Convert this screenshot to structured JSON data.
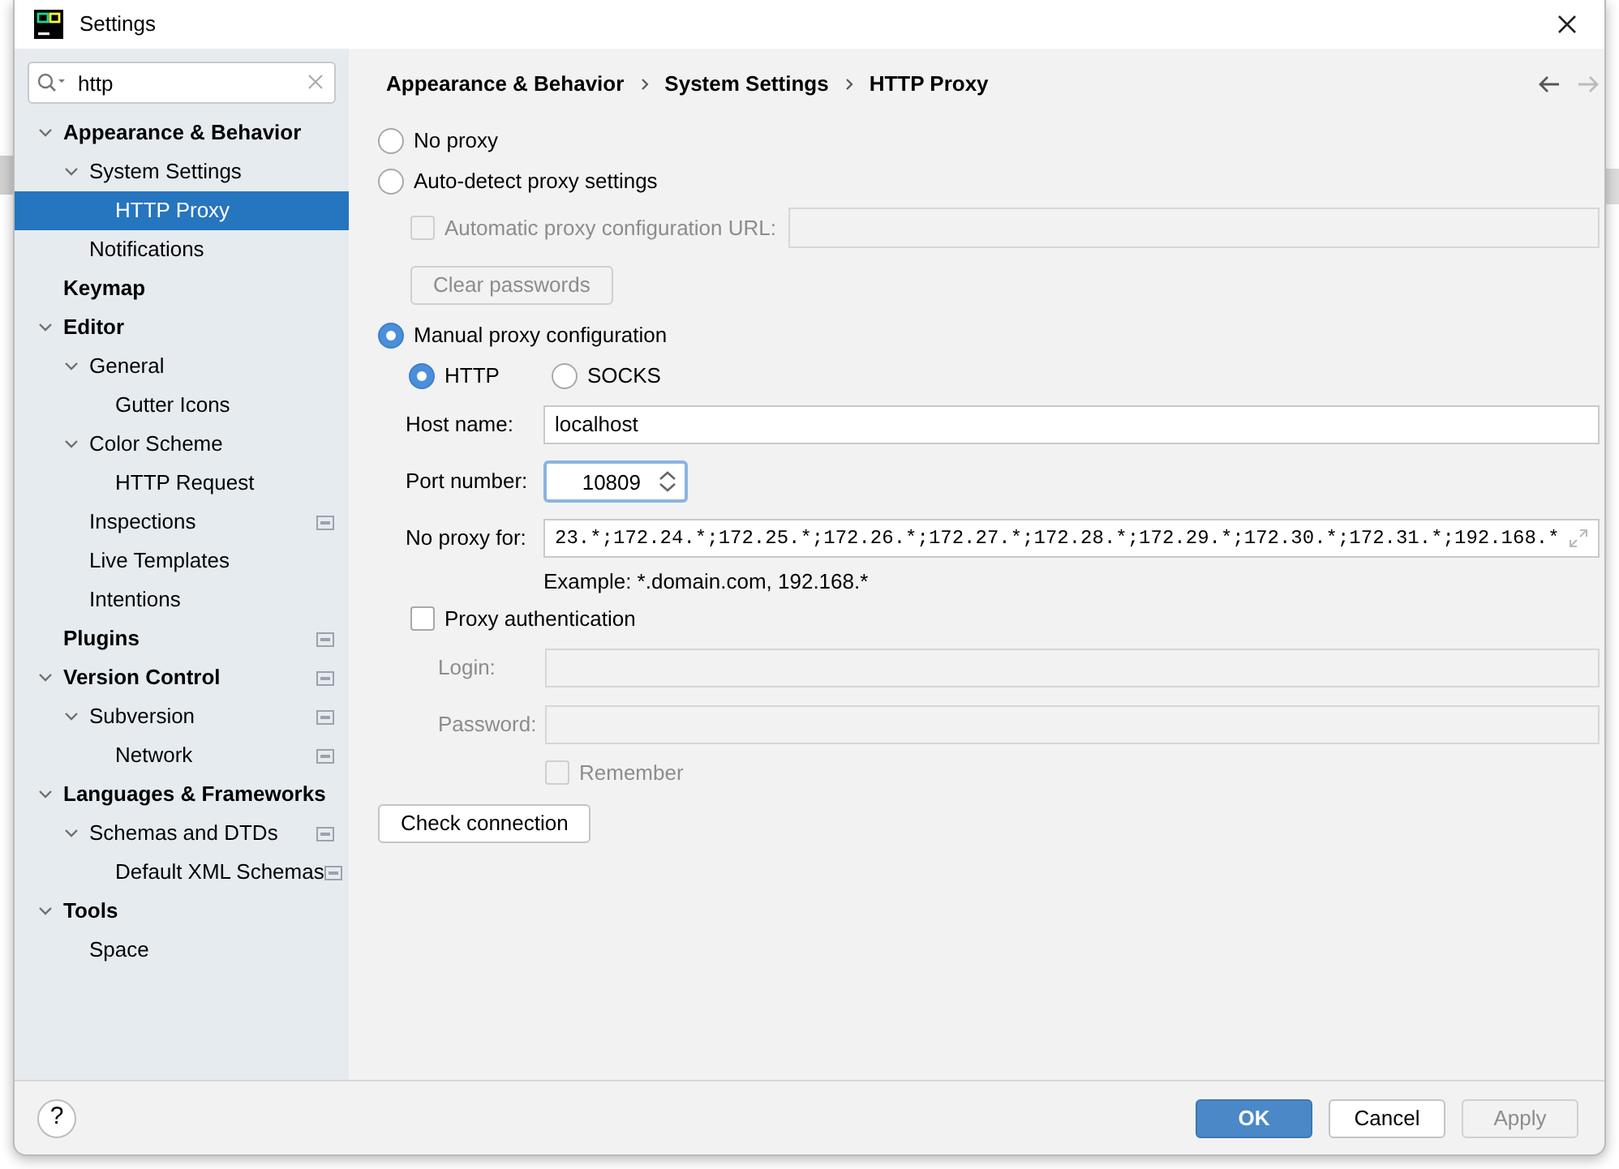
{
  "window": {
    "title": "Settings"
  },
  "search": {
    "value": "http"
  },
  "tree": [
    {
      "label": "Appearance & Behavior",
      "expanded": true,
      "selected": false,
      "children": [
        {
          "label": "System Settings",
          "expanded": true,
          "selected": false,
          "children": [
            {
              "label": "HTTP Proxy",
              "selected": true
            }
          ]
        },
        {
          "label": "Notifications",
          "selected": false
        }
      ]
    },
    {
      "label": "Keymap",
      "selected": false
    },
    {
      "label": "Editor",
      "expanded": true,
      "selected": false,
      "children": [
        {
          "label": "General",
          "expanded": true,
          "selected": false,
          "children": [
            {
              "label": "Gutter Icons",
              "selected": false
            }
          ]
        },
        {
          "label": "Color Scheme",
          "expanded": true,
          "selected": false,
          "children": [
            {
              "label": "HTTP Request",
              "selected": false
            }
          ]
        },
        {
          "label": "Inspections",
          "selected": false,
          "project_scope": true
        },
        {
          "label": "Live Templates",
          "selected": false
        },
        {
          "label": "Intentions",
          "selected": false
        }
      ]
    },
    {
      "label": "Plugins",
      "selected": false,
      "project_scope": true
    },
    {
      "label": "Version Control",
      "expanded": true,
      "selected": false,
      "project_scope": true,
      "children": [
        {
          "label": "Subversion",
          "expanded": true,
          "selected": false,
          "project_scope": true,
          "children": [
            {
              "label": "Network",
              "selected": false,
              "project_scope": true
            }
          ]
        }
      ]
    },
    {
      "label": "Languages & Frameworks",
      "expanded": true,
      "selected": false,
      "children": [
        {
          "label": "Schemas and DTDs",
          "expanded": true,
          "selected": false,
          "project_scope": true,
          "children": [
            {
              "label": "Default XML Schemas",
              "selected": false,
              "project_scope": true
            }
          ]
        }
      ]
    },
    {
      "label": "Tools",
      "expanded": true,
      "selected": false,
      "children": [
        {
          "label": "Space",
          "selected": false
        }
      ]
    }
  ],
  "breadcrumb": [
    "Appearance & Behavior",
    "System Settings",
    "HTTP Proxy"
  ],
  "no_proxy": {
    "label": "No proxy",
    "selected": false
  },
  "auto_detect": {
    "label": "Auto-detect proxy settings",
    "selected": false,
    "url_checkbox": {
      "label": "Automatic proxy configuration URL:",
      "checked": false,
      "disabled": true
    },
    "clear_button": {
      "label": "Clear passwords",
      "disabled": true
    }
  },
  "manual": {
    "label": "Manual proxy configuration",
    "selected": true,
    "protocols": [
      {
        "label": "HTTP",
        "selected": true
      },
      {
        "label": "SOCKS",
        "selected": false
      }
    ],
    "host": {
      "label": "Host name:",
      "value": "localhost"
    },
    "port": {
      "label": "Port number:",
      "value": "10809"
    },
    "no_proxy_for": {
      "label": "No proxy for:",
      "value": "23.*;172.24.*;172.25.*;172.26.*;172.27.*;172.28.*;172.29.*;172.30.*;172.31.*;192.168.*",
      "example": "Example: *.domain.com, 192.168.*"
    },
    "auth": {
      "label": "Proxy authentication",
      "checked": false,
      "login": {
        "label": "Login:",
        "disabled": true
      },
      "password": {
        "label": "Password:",
        "disabled": true
      },
      "remember": {
        "label": "Remember",
        "checked": false,
        "disabled": true
      }
    }
  },
  "check_button": "Check connection",
  "footer": {
    "help": "?",
    "buttons": [
      {
        "label": "OK",
        "kind": "primary",
        "disabled": false
      },
      {
        "label": "Cancel",
        "kind": "default",
        "disabled": false
      },
      {
        "label": "Apply",
        "kind": "default",
        "disabled": true
      }
    ]
  }
}
